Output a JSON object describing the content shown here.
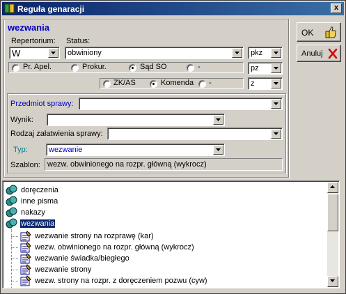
{
  "window": {
    "title": "Reguła genaracji",
    "close": "x"
  },
  "header": {
    "heading": "wezwania"
  },
  "labels": {
    "repertorium": "Repertorium:",
    "status": "Status:",
    "przedmiot": "Przedmiot sprawy:",
    "wynik": "Wynik:",
    "rodzaj": "Rodzaj załatwienia sprawy:",
    "typ": "Typ:",
    "szablon": "Szablon:"
  },
  "fields": {
    "repertorium": "W",
    "status": "obwiniony",
    "pkz": "pkz",
    "pz": "pz",
    "z": "z",
    "przedmiot": "",
    "wynik": "",
    "rodzaj": "",
    "typ": "wezwanie",
    "szablon": "wezw. obwinionego na rozpr. główną (wykrocz)"
  },
  "radios1": [
    {
      "label": "Pr. Apel.",
      "checked": false
    },
    {
      "label": "Prokur.",
      "checked": false
    },
    {
      "label": "Sąd SO",
      "checked": true
    },
    {
      "label": "-",
      "checked": false
    }
  ],
  "radios2": [
    {
      "label": "ZK/AS",
      "checked": false
    },
    {
      "label": "Komenda",
      "checked": true
    },
    {
      "label": "-",
      "checked": false
    }
  ],
  "buttons": {
    "ok": "OK",
    "anuluj": "Anuluj"
  },
  "tree": {
    "groups": [
      "doręczenia",
      "inne pisma",
      "nakazy",
      "wezwania"
    ],
    "children": [
      "wezwanie strony na rozprawę (kar)",
      "wezw. obwinionego na rozpr. główną (wykrocz)",
      "wezwanie świadka/biegłego",
      "wezwanie strony",
      "wezw. strony na rozpr. z doręczeniem pozwu (cyw)"
    ]
  },
  "colors": {
    "title_start": "#0a246a",
    "title_end": "#3a6ea5",
    "accent_blue": "#0000c8",
    "typ_label": "#00808f"
  }
}
